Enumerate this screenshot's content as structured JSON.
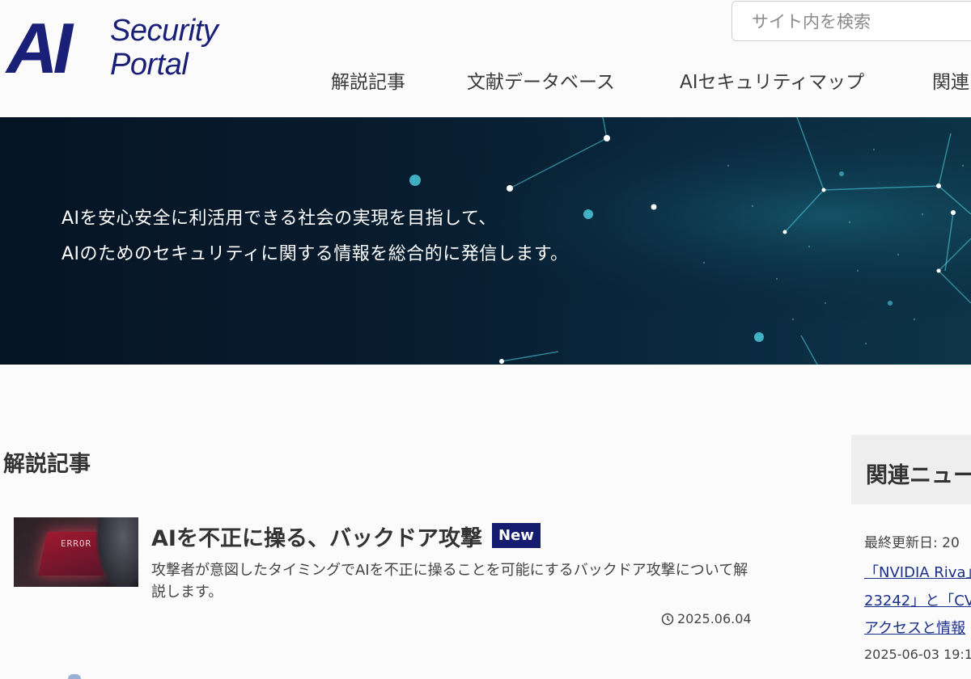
{
  "logo": {
    "mark": "AI",
    "line1": "Security",
    "line2": "Portal"
  },
  "search": {
    "placeholder": "サイト内を検索",
    "value": ""
  },
  "nav": {
    "items": [
      {
        "label": "解説記事"
      },
      {
        "label": "文献データベース"
      },
      {
        "label": "AIセキュリティマップ"
      },
      {
        "label": "関連"
      }
    ]
  },
  "hero": {
    "line1": "AIを安心安全に利活用できる社会の実現を目指して、",
    "line2": "AIのためのセキュリティに関する情報を総合的に発信します。"
  },
  "main": {
    "section_title": "解説記事",
    "articles": [
      {
        "thumb_text": "ERROR",
        "title": "AIを不正に操る、バックドア攻撃",
        "badge": "New",
        "description": "攻撃者が意図したタイミングでAIを不正に操ることを可能にするバックドア攻撃について解説します。",
        "date": "2025.06.04"
      }
    ]
  },
  "sidebar": {
    "title": "関連ニュー",
    "updated": "最終更新日: 20",
    "news": [
      {
        "lines": [
          "「NVIDIA Riva」",
          "23242」と「CV",
          "アクセスと情報"
        ],
        "date": "2025-06-03 19:1"
      }
    ]
  },
  "colors": {
    "brand": "#1a2078",
    "badge": "#151b6e",
    "hero_bg": "#081d30",
    "link": "#1a2f8a"
  }
}
